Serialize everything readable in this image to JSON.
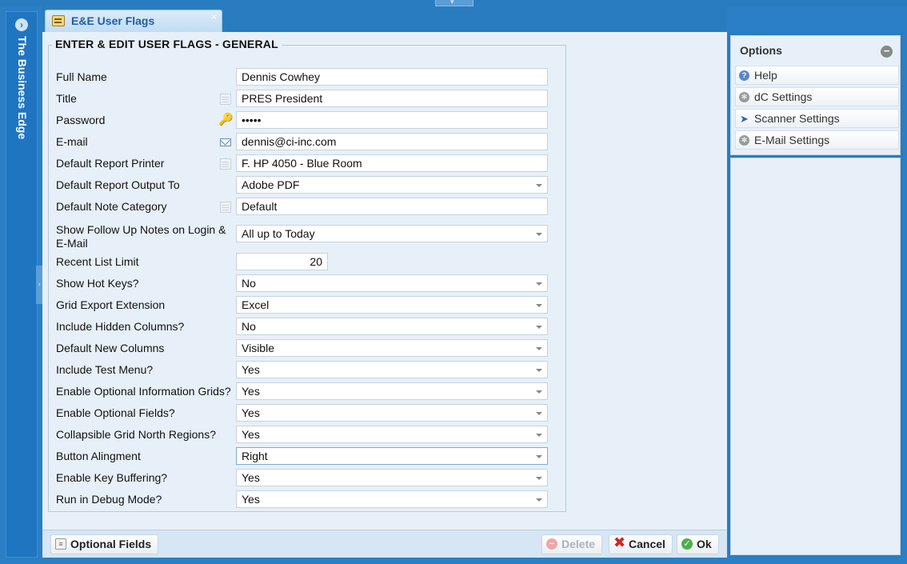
{
  "sidebar": {
    "title": "The Business Edge",
    "expand_glyph": "›"
  },
  "tab": {
    "label": "E&E User Flags",
    "close": "×"
  },
  "form": {
    "legend": "ENTER & EDIT USER FLAGS - GENERAL",
    "rows": [
      {
        "label": "Full Name",
        "value": "Dennis Cowhey"
      },
      {
        "label": "Title",
        "value": "PRES  President",
        "icon": "lookup-icon"
      },
      {
        "label": "Password",
        "value": "•••••",
        "icon": "key-icon"
      },
      {
        "label": "E-mail",
        "value": "dennis@ci-inc.com",
        "icon": "envelope-icon"
      },
      {
        "label": "Default Report Printer",
        "value": "F. HP 4050 - Blue Room",
        "icon": "lookup-icon"
      },
      {
        "label": "Default Report Output To",
        "value": "Adobe PDF"
      },
      {
        "label": "Default Note Category",
        "value": "Default",
        "icon": "lookup-icon"
      },
      {
        "label": "Show Follow Up Notes on Login & E-Mail",
        "value": "All up to Today"
      },
      {
        "label": "Recent List Limit",
        "value": "20"
      },
      {
        "label": "Show Hot Keys?",
        "value": "No"
      },
      {
        "label": "Grid Export Extension",
        "value": "Excel"
      },
      {
        "label": "Include Hidden Columns?",
        "value": "No"
      },
      {
        "label": "Default New Columns",
        "value": "Visible"
      },
      {
        "label": "Include Test Menu?",
        "value": "Yes"
      },
      {
        "label": "Enable Optional Information Grids?",
        "value": "Yes"
      },
      {
        "label": "Enable Optional Fields?",
        "value": "Yes"
      },
      {
        "label": "Collapsible Grid North Regions?",
        "value": "Yes"
      },
      {
        "label": "Button Alingment",
        "value": "Right"
      },
      {
        "label": "Enable Key Buffering?",
        "value": "Yes"
      },
      {
        "label": "Run in Debug Mode?",
        "value": "Yes"
      }
    ]
  },
  "toolbar": {
    "optional_fields": "Optional Fields",
    "delete": "Delete",
    "cancel": "Cancel",
    "ok": "Ok"
  },
  "options": {
    "title": "Options",
    "collapse_glyph": "−",
    "items": [
      "Help",
      "dC Settings",
      "Scanner Settings",
      "E-Mail Settings"
    ]
  }
}
